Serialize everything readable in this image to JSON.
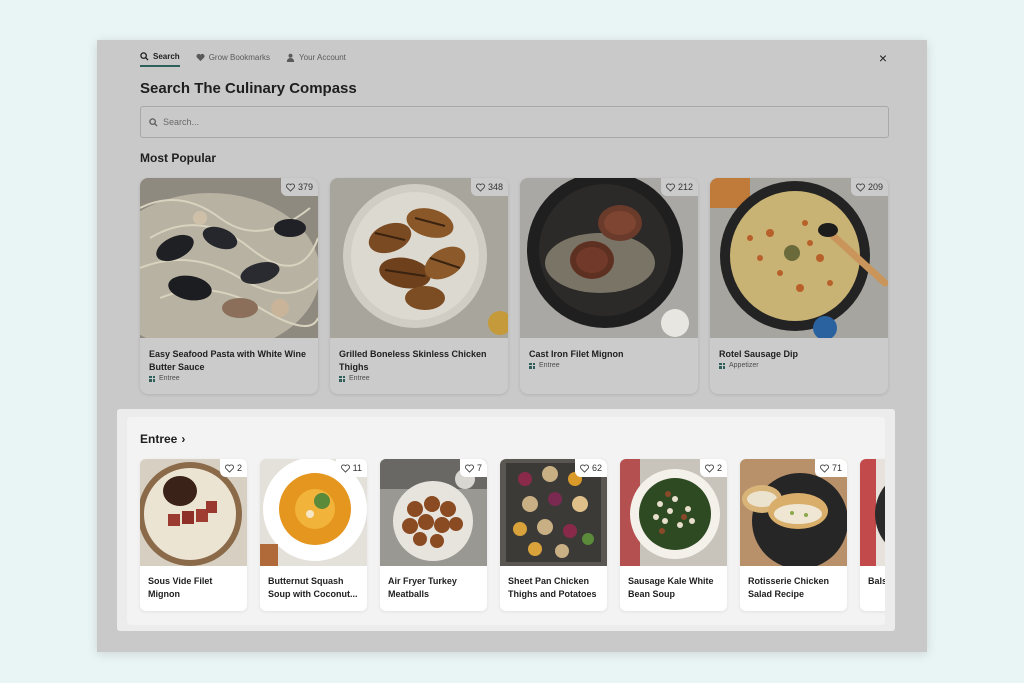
{
  "tabs": [
    {
      "label": "Search",
      "icon": "search-icon"
    },
    {
      "label": "Grow Bookmarks",
      "icon": "heart-icon"
    },
    {
      "label": "Your Account",
      "icon": "user-icon"
    }
  ],
  "close_label": "×",
  "title": "Search The Culinary Compass",
  "search": {
    "placeholder": "Search..."
  },
  "most_popular": {
    "title": "Most Popular",
    "items": [
      {
        "name": "Easy Seafood Pasta with White Wine Butter Sauce",
        "category": "Entree",
        "likes": "379"
      },
      {
        "name": "Grilled Boneless Skinless Chicken Thighs",
        "category": "Entree",
        "likes": "348"
      },
      {
        "name": "Cast Iron Filet Mignon",
        "category": "Entree",
        "likes": "212"
      },
      {
        "name": "Rotel Sausage Dip",
        "category": "Appetizer",
        "likes": "209"
      }
    ]
  },
  "entree": {
    "title": "Entree",
    "chevron": "›",
    "items": [
      {
        "name": "Sous Vide Filet Mignon",
        "likes": "2"
      },
      {
        "name": "Butternut Squash Soup with Coconut...",
        "likes": "11"
      },
      {
        "name": "Air Fryer Turkey Meatballs",
        "likes": "7"
      },
      {
        "name": "Sheet Pan Chicken Thighs and Potatoes",
        "likes": "62"
      },
      {
        "name": "Sausage Kale White Bean Soup",
        "likes": "2"
      },
      {
        "name": "Rotisserie Chicken Salad Recipe",
        "likes": "71"
      },
      {
        "name": "Balsamic Chicken",
        "likes": ""
      }
    ]
  },
  "colors": {
    "accent": "#2f5f5a",
    "overlay": "#c9c9c9",
    "background": "#e9f4f4"
  }
}
